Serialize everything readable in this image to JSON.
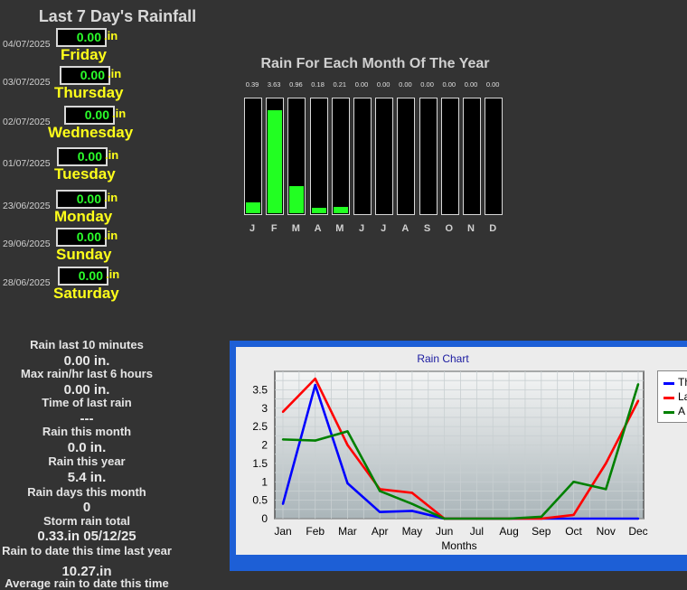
{
  "page_title": "Last 7 Day's Rainfall",
  "last7": {
    "unit": ".in",
    "days": [
      {
        "date": "04/07/2025",
        "value": "0.00",
        "name": "Friday"
      },
      {
        "date": "03/07/2025",
        "value": "0.00",
        "name": "Thursday"
      },
      {
        "date": "02/07/2025",
        "value": "0.00",
        "name": "Wednesday"
      },
      {
        "date": "01/07/2025",
        "value": "0.00",
        "name": "Tuesday"
      },
      {
        "date": "23/06/2025",
        "value": "0.00",
        "name": "Monday"
      },
      {
        "date": "29/06/2025",
        "value": "0.00",
        "name": "Sunday"
      },
      {
        "date": "28/06/2025",
        "value": "0.00",
        "name": "Saturday"
      }
    ]
  },
  "month_chart": {
    "title": "Rain For Each Month Of The Year",
    "letters": [
      "J",
      "F",
      "M",
      "A",
      "M",
      "J",
      "J",
      "A",
      "S",
      "O",
      "N",
      "D"
    ],
    "value_labels": [
      "0.39",
      "3.63",
      "0.96",
      "0.18",
      "0.21",
      "0.00",
      "0.00",
      "0.00",
      "0.00",
      "0.00",
      "0.00",
      "0.00"
    ],
    "values": [
      0.39,
      3.63,
      0.96,
      0.18,
      0.21,
      0,
      0,
      0,
      0,
      0,
      0,
      0
    ],
    "max": 4.0,
    "fill_color": "#22ff22"
  },
  "stats": [
    {
      "label": "Rain last 10 minutes",
      "value": "0.00 in."
    },
    {
      "label": "Max rain/hr last 6 hours",
      "value": "0.00 in."
    },
    {
      "label": "Time of last rain",
      "value": "---"
    },
    {
      "label": "Rain this month",
      "value": "0.0 in."
    },
    {
      "label": "Rain this year",
      "value": "5.4 in."
    },
    {
      "label": "Rain days this month",
      "value": "0"
    },
    {
      "label": "Storm rain total",
      "value": "0.33.in 05/12/25"
    },
    {
      "label": "Rain to date this time last year",
      "value": "10.27.in"
    },
    {
      "label": "Average rain to date this time",
      "value": ""
    }
  ],
  "chart_data": {
    "type": "line",
    "title": "Rain Chart",
    "xlabel": "Months",
    "ylabel": "",
    "categories": [
      "Jan",
      "Feb",
      "Mar",
      "Apr",
      "May",
      "Jun",
      "Jul",
      "Aug",
      "Sep",
      "Oct",
      "Nov",
      "Dec"
    ],
    "ylim": [
      0,
      4
    ],
    "yticks": [
      "0",
      "0.5",
      "1",
      "1.5",
      "2",
      "2.5",
      "3",
      "3.5"
    ],
    "grid": true,
    "legend_placement": "right",
    "series": [
      {
        "name": "Th",
        "color": "#0000ff",
        "values": [
          0.4,
          3.63,
          0.96,
          0.18,
          0.21,
          0,
          0,
          0,
          0,
          0,
          0,
          0
        ]
      },
      {
        "name": "La",
        "color": "#ff0000",
        "values": [
          2.9,
          3.8,
          2.0,
          0.8,
          0.7,
          0,
          0,
          0,
          0,
          0.1,
          1.5,
          3.2
        ]
      },
      {
        "name": "A",
        "color": "#008000",
        "values": [
          2.15,
          2.12,
          2.37,
          0.75,
          0.4,
          0,
          0,
          0,
          0.05,
          1.0,
          0.8,
          3.65
        ]
      }
    ]
  }
}
